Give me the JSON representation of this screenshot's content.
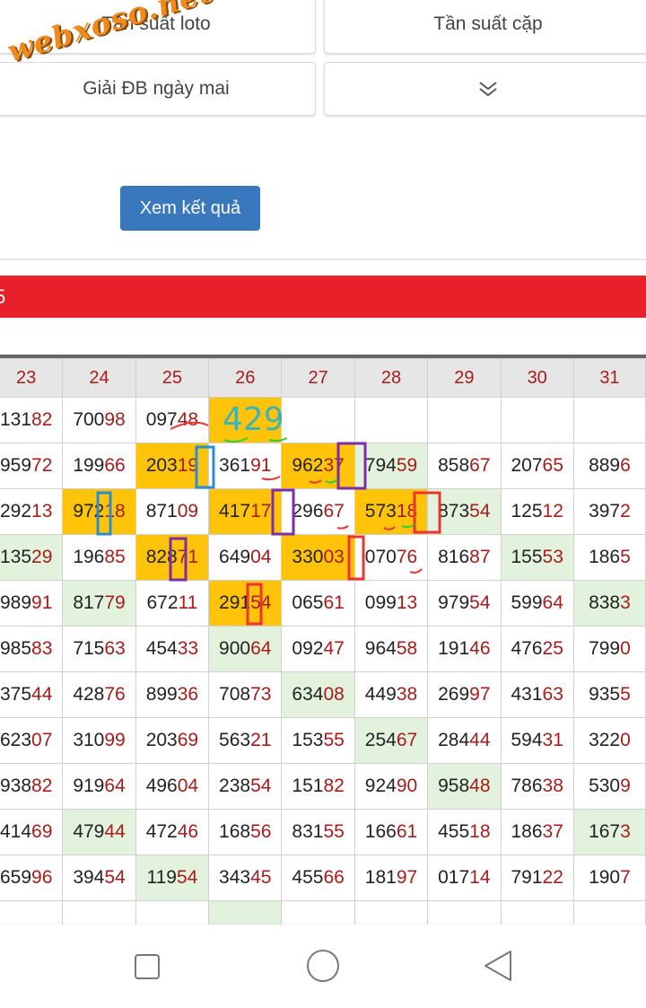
{
  "watermark": "webxoso.net",
  "buttons": {
    "freq_loto": "Tần suất loto",
    "freq_pair": "Tần suất cặp",
    "special_tomorrow": "Giải ĐB ngày mai"
  },
  "view_button": "Xem kết quả",
  "red_bar_text": "5",
  "table": {
    "headers": [
      "23",
      "24",
      "25",
      "26",
      "27",
      "28",
      "29",
      "30",
      "31"
    ],
    "rows": [
      [
        [
          "131",
          "82",
          ""
        ],
        [
          "700",
          "98",
          ""
        ],
        [
          "097",
          "48",
          ""
        ],
        [
          "",
          "",
          "y"
        ],
        [
          "",
          "",
          ""
        ],
        [
          "",
          "",
          ""
        ],
        [
          "",
          "",
          ""
        ],
        [
          "",
          "",
          ""
        ],
        [
          "",
          "",
          ""
        ]
      ],
      [
        [
          "959",
          "72",
          ""
        ],
        [
          "199",
          "66",
          ""
        ],
        [
          "203",
          "19",
          "y"
        ],
        [
          "361",
          "91",
          ""
        ],
        [
          "962",
          "37",
          "y"
        ],
        [
          "794",
          "59",
          "g"
        ],
        [
          "858",
          "67",
          ""
        ],
        [
          "207",
          "65",
          ""
        ],
        [
          "889",
          "6",
          ""
        ]
      ],
      [
        [
          "292",
          "13",
          ""
        ],
        [
          "972",
          "18",
          "y"
        ],
        [
          "871",
          "09",
          ""
        ],
        [
          "417",
          "17",
          "y"
        ],
        [
          "296",
          "67",
          ""
        ],
        [
          "573",
          "18",
          "y"
        ],
        [
          "873",
          "54",
          "g"
        ],
        [
          "125",
          "12",
          ""
        ],
        [
          "397",
          "2",
          ""
        ]
      ],
      [
        [
          "135",
          "29",
          "g"
        ],
        [
          "196",
          "85",
          ""
        ],
        [
          "828",
          "71",
          "y"
        ],
        [
          "649",
          "04",
          ""
        ],
        [
          "330",
          "03",
          "y"
        ],
        [
          "070",
          "76",
          ""
        ],
        [
          "816",
          "87",
          ""
        ],
        [
          "155",
          "53",
          "g"
        ],
        [
          "186",
          "5",
          ""
        ]
      ],
      [
        [
          "989",
          "91",
          ""
        ],
        [
          "817",
          "79",
          "g"
        ],
        [
          "672",
          "11",
          ""
        ],
        [
          "291",
          "54",
          "y"
        ],
        [
          "065",
          "61",
          ""
        ],
        [
          "099",
          "13",
          ""
        ],
        [
          "979",
          "54",
          ""
        ],
        [
          "599",
          "64",
          ""
        ],
        [
          "838",
          "3",
          "g"
        ]
      ],
      [
        [
          "985",
          "83",
          ""
        ],
        [
          "715",
          "63",
          ""
        ],
        [
          "454",
          "33",
          ""
        ],
        [
          "900",
          "64",
          "g"
        ],
        [
          "092",
          "47",
          ""
        ],
        [
          "964",
          "58",
          ""
        ],
        [
          "191",
          "46",
          ""
        ],
        [
          "476",
          "25",
          ""
        ],
        [
          "799",
          "0",
          ""
        ]
      ],
      [
        [
          "375",
          "44",
          ""
        ],
        [
          "428",
          "76",
          ""
        ],
        [
          "899",
          "36",
          ""
        ],
        [
          "708",
          "73",
          ""
        ],
        [
          "634",
          "08",
          "g"
        ],
        [
          "449",
          "38",
          ""
        ],
        [
          "269",
          "97",
          ""
        ],
        [
          "431",
          "63",
          ""
        ],
        [
          "935",
          "5",
          ""
        ]
      ],
      [
        [
          "623",
          "07",
          ""
        ],
        [
          "310",
          "99",
          ""
        ],
        [
          "203",
          "69",
          ""
        ],
        [
          "563",
          "21",
          ""
        ],
        [
          "153",
          "55",
          ""
        ],
        [
          "254",
          "67",
          "g"
        ],
        [
          "284",
          "44",
          ""
        ],
        [
          "594",
          "31",
          ""
        ],
        [
          "322",
          "0",
          ""
        ]
      ],
      [
        [
          "938",
          "82",
          ""
        ],
        [
          "919",
          "64",
          ""
        ],
        [
          "496",
          "04",
          ""
        ],
        [
          "238",
          "54",
          ""
        ],
        [
          "151",
          "82",
          ""
        ],
        [
          "924",
          "90",
          ""
        ],
        [
          "958",
          "48",
          "g"
        ],
        [
          "786",
          "38",
          ""
        ],
        [
          "530",
          "9",
          ""
        ]
      ],
      [
        [
          "414",
          "69",
          ""
        ],
        [
          "479",
          "44",
          "g"
        ],
        [
          "472",
          "46",
          ""
        ],
        [
          "168",
          "56",
          ""
        ],
        [
          "831",
          "55",
          ""
        ],
        [
          "166",
          "61",
          ""
        ],
        [
          "455",
          "18",
          ""
        ],
        [
          "186",
          "37",
          ""
        ],
        [
          "167",
          "3",
          "g"
        ]
      ],
      [
        [
          "659",
          "96",
          ""
        ],
        [
          "394",
          "54",
          ""
        ],
        [
          "119",
          "54",
          "g"
        ],
        [
          "343",
          "45",
          ""
        ],
        [
          "455",
          "66",
          ""
        ],
        [
          "181",
          "97",
          ""
        ],
        [
          "017",
          "14",
          ""
        ],
        [
          "791",
          "22",
          ""
        ],
        [
          "190",
          "7",
          ""
        ]
      ],
      [
        [
          "",
          "",
          ""
        ],
        [
          "",
          "",
          ""
        ],
        [
          "",
          "",
          ""
        ],
        [
          "",
          "",
          "g"
        ],
        [
          "",
          "",
          ""
        ],
        [
          "",
          "",
          ""
        ],
        [
          "",
          "",
          ""
        ],
        [
          "",
          "",
          ""
        ],
        [
          "",
          "",
          ""
        ]
      ]
    ]
  },
  "handwritten_note": "429",
  "nav": {
    "recents": "square-icon",
    "home": "circle-icon",
    "back": "triangle-back-icon"
  }
}
